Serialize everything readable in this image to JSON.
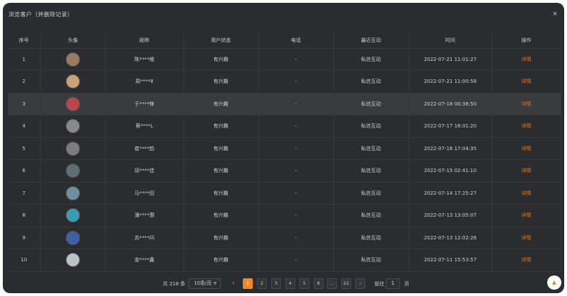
{
  "dialog": {
    "title": "浏览客户（并删除记录）",
    "close_label": "×"
  },
  "table": {
    "headers": [
      "序号",
      "头像",
      "昵称",
      "用户状态",
      "电话",
      "最近互动",
      "时间",
      "操作"
    ],
    "rows": [
      {
        "index": "1",
        "nickname": "陈****维",
        "status": "有兴趣",
        "phone": "-",
        "interaction": "私信互动",
        "time": "2022-07-21 11:01:27",
        "action": "详情",
        "avatar_color": "#9b7a62"
      },
      {
        "index": "2",
        "nickname": "周****8",
        "status": "有兴趣",
        "phone": "-",
        "interaction": "私信互动",
        "time": "2022-07-21 11:00:58",
        "action": "详情",
        "avatar_color": "#c9a27a"
      },
      {
        "index": "3",
        "nickname": "于****锋",
        "status": "有兴趣",
        "phone": "-",
        "interaction": "私信互动",
        "time": "2022-07-18 00:38:50",
        "action": "详情",
        "avatar_color": "#b84848"
      },
      {
        "index": "4",
        "nickname": "蔡****L",
        "status": "有兴趣",
        "phone": "-",
        "interaction": "私信互动",
        "time": "2022-07-17 16:01:20",
        "action": "详情",
        "avatar_color": "#8a8a8a"
      },
      {
        "index": "5",
        "nickname": "崔****韵",
        "status": "有兴趣",
        "phone": "-",
        "interaction": "私信互动",
        "time": "2022-07-16 17:04:35",
        "action": "详情",
        "avatar_color": "#7d7d7d"
      },
      {
        "index": "6",
        "nickname": "邱****佳",
        "status": "有兴趣",
        "phone": "-",
        "interaction": "私信互动",
        "time": "2022-07-15 02:41:10",
        "action": "详情",
        "avatar_color": "#5e6e72"
      },
      {
        "index": "7",
        "nickname": "马****田",
        "status": "有兴趣",
        "phone": "-",
        "interaction": "私信互动",
        "time": "2022-07-14 17:25:27",
        "action": "详情",
        "avatar_color": "#6f8fa5"
      },
      {
        "index": "8",
        "nickname": "潘****灏",
        "status": "有兴趣",
        "phone": "-",
        "interaction": "私信互动",
        "time": "2022-07-13 13:05:07",
        "action": "详情",
        "avatar_color": "#3a9bb4"
      },
      {
        "index": "9",
        "nickname": "苏****问",
        "status": "有兴趣",
        "phone": "-",
        "interaction": "私信互动",
        "time": "2022-07-13 12:02:26",
        "action": "详情",
        "avatar_color": "#3f5fa8"
      },
      {
        "index": "10",
        "nickname": "金****鑫",
        "status": "有兴趣",
        "phone": "-",
        "interaction": "私信互动",
        "time": "2022-07-11 15:53:57",
        "action": "详情",
        "avatar_color": "#b9c3c9"
      }
    ]
  },
  "pagination": {
    "total": "共 216 条",
    "page_size": "10条/页",
    "prev_label": "‹",
    "pages": [
      "1",
      "2",
      "3",
      "4",
      "5",
      "6",
      "…",
      "22",
      "›"
    ],
    "active_page": "1",
    "goto_label": "前往",
    "goto_value": "1",
    "page_word": "页"
  },
  "back_to_top": "▲",
  "colors": {
    "panel_bg": "#2b2c30",
    "accent": "#f08a24",
    "highlight_row": "#3a3b3f"
  }
}
